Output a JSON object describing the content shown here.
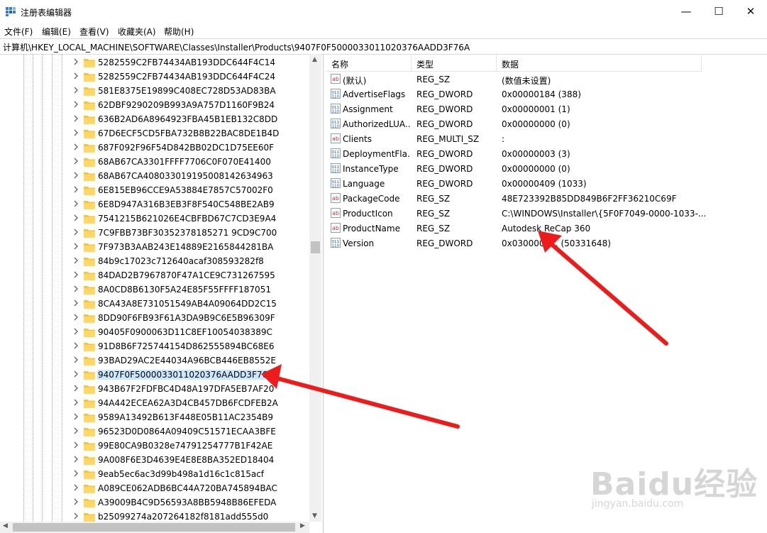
{
  "window": {
    "title": "注册表编辑器",
    "minimize": "—",
    "maximize": "☐",
    "close": "✕"
  },
  "menu": [
    "文件(F)",
    "编辑(E)",
    "查看(V)",
    "收藏夹(A)",
    "帮助(H)"
  ],
  "address": "计算机\\HKEY_LOCAL_MACHINE\\SOFTWARE\\Classes\\Installer\\Products\\9407F0F5000033011020376AADD3F76A",
  "tree": {
    "items": [
      "5282559C2FB74434AB193DDC644F4C14",
      "5282559C2FB74434AB193DDC644F4C24",
      "581E8375E19899C408EC728D53AD83BA",
      "62DBF9290209B993A9A757D1160F9B24",
      "636B2AD6A8964923FBA45B1EB132C8DD",
      "67D6ECF5CD5FBA732B8B22BAC8DE1B4D",
      "687F092F96F54D842BB02DC1D75EE60F",
      "68AB67CA3301FFFF7706C0F070E41400",
      "68AB67CA408033019195008142634963",
      "6E815EB96CCE9A53884E7857C57002F0",
      "6E8D947A316B3EB3F8F540C548BE2AB9",
      "7541215B621026E4CBFBD67C7CD3E9A4",
      "7C9FBB73BF30352378185271 9CD9C700",
      "7F973B3AAB243E14889E2165844281BA",
      "84b9c17023c712640acaf308593282f8",
      "84DAD2B7967870F47A1CE9C731267595",
      "8A0CD8B6130F5A24E85F55FFFF187051",
      "8CA43A8E731051549AB4A09064DD2C15",
      "8DD90F6FB93F61A3DA9B9C6E5B96309F",
      "90405F0900063D11C8EF10054038389C",
      "91D8B6F725744154D862555894BC68E6",
      "93BAD29AC2E44034A96BCB446EB8552E",
      "9407F0F5000033011020376AADD3F76A",
      "943B67F2FDFBC4D48A197DFA5EB7AF20",
      "94A442ECEA62A3D4CB457DB6FCDFEB2A",
      "9589A13492B613F448E05B11AC2354B9",
      "96523D0D0864A09409C51571ECAA3BFE",
      "99E80CA9B0328e74791254777B1F42AE",
      "9A008F6E3D4639E4E8E8BA352ED18404",
      "9eab5ec6ac3d99b498a1d16c1c815acf",
      "A089CE062ADB6BC44A720BA745894BAC",
      "A39009B4C9D56593A8BB5948B86EFEDA",
      "b25099274a207264182f8181add555d0"
    ],
    "selected_index": 22
  },
  "list": {
    "headers": {
      "name": "名称",
      "type": "类型",
      "data": "数据"
    },
    "rows": [
      {
        "icon": "string-value-icon",
        "name": "(默认)",
        "type": "REG_SZ",
        "data": "(数值未设置)"
      },
      {
        "icon": "binary-value-icon",
        "name": "AdvertiseFlags",
        "type": "REG_DWORD",
        "data": "0x00000184 (388)"
      },
      {
        "icon": "binary-value-icon",
        "name": "Assignment",
        "type": "REG_DWORD",
        "data": "0x00000001 (1)"
      },
      {
        "icon": "binary-value-icon",
        "name": "AuthorizedLUA...",
        "type": "REG_DWORD",
        "data": "0x00000000 (0)"
      },
      {
        "icon": "string-value-icon",
        "name": "Clients",
        "type": "REG_MULTI_SZ",
        "data": ":"
      },
      {
        "icon": "binary-value-icon",
        "name": "DeploymentFla...",
        "type": "REG_DWORD",
        "data": "0x00000003 (3)"
      },
      {
        "icon": "binary-value-icon",
        "name": "InstanceType",
        "type": "REG_DWORD",
        "data": "0x00000000 (0)"
      },
      {
        "icon": "binary-value-icon",
        "name": "Language",
        "type": "REG_DWORD",
        "data": "0x00000409 (1033)"
      },
      {
        "icon": "string-value-icon",
        "name": "PackageCode",
        "type": "REG_SZ",
        "data": "48E723392B85DD849B6F2FF36210C69F"
      },
      {
        "icon": "string-value-icon",
        "name": "ProductIcon",
        "type": "REG_SZ",
        "data": "C:\\WINDOWS\\Installer\\{5F0F7049-0000-1033-..."
      },
      {
        "icon": "string-value-icon",
        "name": "ProductName",
        "type": "REG_SZ",
        "data": "Autodesk ReCap 360"
      },
      {
        "icon": "binary-value-icon",
        "name": "Version",
        "type": "REG_DWORD",
        "data": "0x0300000... (50331648)"
      }
    ]
  },
  "watermark": {
    "brand": "Baidu经验",
    "url": "jingyan.baidu.com"
  },
  "colors": {
    "selection": "#cce8ff",
    "folder": "#f5c542",
    "arrow": "#ee1b1b"
  }
}
